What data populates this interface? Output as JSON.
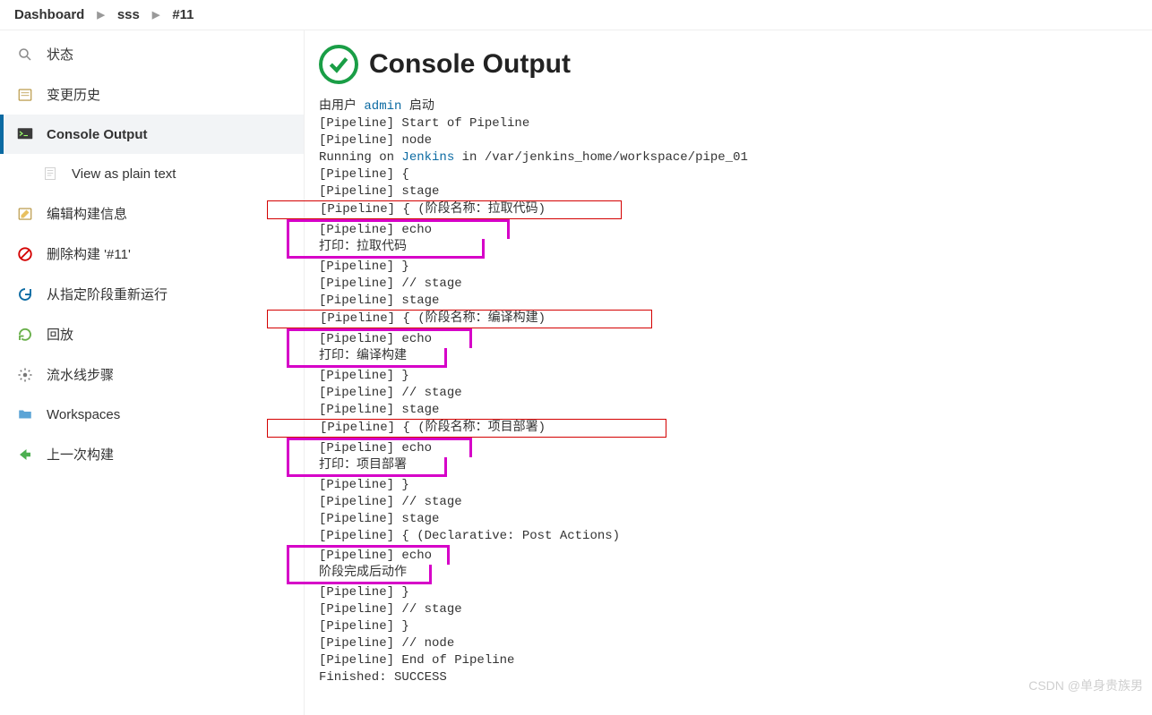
{
  "breadcrumb": {
    "items": [
      "Dashboard",
      "sss",
      "#11"
    ]
  },
  "sidebar": {
    "items": [
      {
        "label": "状态"
      },
      {
        "label": "变更历史"
      },
      {
        "label": "Console Output"
      },
      {
        "label": "View as plain text"
      },
      {
        "label": "编辑构建信息"
      },
      {
        "label": "删除构建 '#11'"
      },
      {
        "label": "从指定阶段重新运行"
      },
      {
        "label": "回放"
      },
      {
        "label": "流水线步骤"
      },
      {
        "label": "Workspaces"
      },
      {
        "label": "上一次构建"
      }
    ]
  },
  "main": {
    "title": "Console Output",
    "started_by_prefix": "由用户 ",
    "started_by_user": "admin",
    "started_by_suffix": " 启动",
    "running_prefix": "Running on ",
    "running_node": "Jenkins",
    "running_suffix": " in /var/jenkins_home/workspace/pipe_01",
    "lines": {
      "l1": "[Pipeline] Start of Pipeline",
      "l2": "[Pipeline] node",
      "l4": "[Pipeline] {",
      "l5": "[Pipeline] stage",
      "l6": "[Pipeline] { (阶段名称：拉取代码)          ",
      "l7": "[Pipeline] echo          ",
      "l8": "打印：拉取代码          ",
      "l9": "[Pipeline] }",
      "l10": "[Pipeline] // stage",
      "l11": "[Pipeline] stage",
      "l12": "[Pipeline] { (阶段名称：编译构建)              ",
      "l13": "[Pipeline] echo     ",
      "l14": "打印：编译构建     ",
      "l15": "[Pipeline] }",
      "l16": "[Pipeline] // stage",
      "l17": "[Pipeline] stage",
      "l18": "[Pipeline] { (阶段名称：项目部署)                ",
      "l19": "[Pipeline] echo     ",
      "l20": "打印：项目部署     ",
      "l21": "[Pipeline] }",
      "l22": "[Pipeline] // stage",
      "l23": "[Pipeline] stage",
      "l24": "[Pipeline] { (Declarative: Post Actions)",
      "l25": "[Pipeline] echo  ",
      "l26": "阶段完成后动作   ",
      "l27": "[Pipeline] }",
      "l28": "[Pipeline] // stage",
      "l29": "[Pipeline] }",
      "l30": "[Pipeline] // node",
      "l31": "[Pipeline] End of Pipeline",
      "l32": "Finished: SUCCESS"
    }
  },
  "watermark": "CSDN @单身贵族男"
}
